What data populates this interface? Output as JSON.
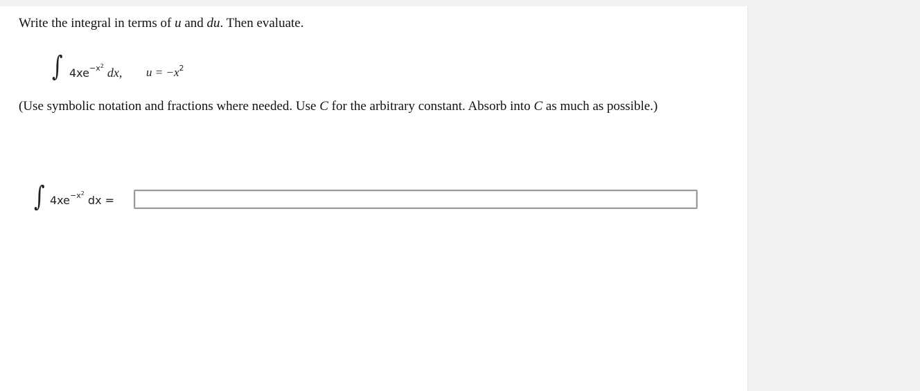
{
  "question": {
    "instruction": {
      "part1": "Write the integral in terms of ",
      "u": "u",
      "part2": " and ",
      "du": "du",
      "part3": ". Then evaluate."
    },
    "problem": {
      "integral_symbol": "∫",
      "integrand_base": "4xe",
      "exponent": "−x",
      "exponent_power": "2",
      "differential": "dx,",
      "substitution_lhs": "u = −x",
      "substitution_power": "2"
    },
    "note": {
      "part1": "(Use symbolic notation and fractions where needed. Use ",
      "c1": "C",
      "part2": " for the arbitrary constant. Absorb into ",
      "c2": "C",
      "part3": " as much as possible.)"
    }
  },
  "answer": {
    "integral_symbol": "∫",
    "integrand_base": "4xe",
    "exponent": "−x",
    "exponent_power": "2",
    "differential": "dx =",
    "input_value": "",
    "input_placeholder": ""
  }
}
